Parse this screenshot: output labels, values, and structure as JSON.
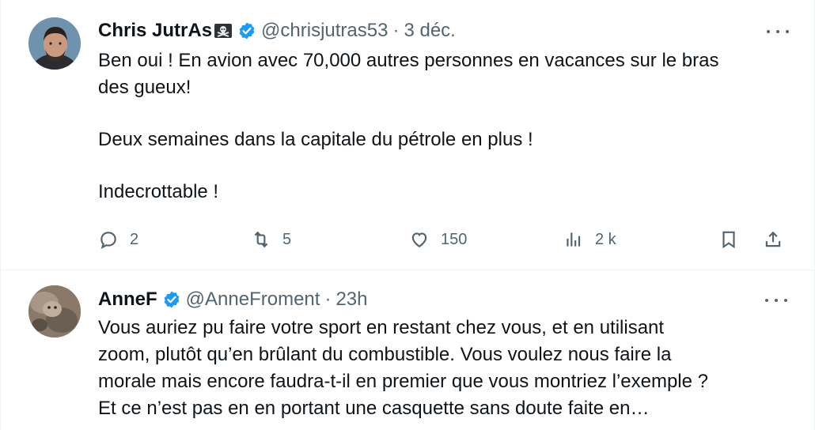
{
  "tweets": [
    {
      "author_name": "Chris JutrAs",
      "author_emoji": "pirate-flag-emoji",
      "handle": "@chrisjutras53",
      "separator": "·",
      "date": "3 déc.",
      "text_lines": [
        "Ben oui ! En avion avec 70,000 autres personnes en vacances sur le bras",
        "des gueux!",
        "",
        "Deux semaines dans la capitale du pétrole en plus !",
        "",
        "Indecrottable !"
      ],
      "actions": {
        "replies": "2",
        "reposts": "5",
        "likes": "150",
        "views": "2 k"
      }
    },
    {
      "author_name": "AnneF",
      "handle": "@AnneFroment",
      "separator": "·",
      "date": "23h",
      "text_lines": [
        "Vous auriez pu faire votre sport en restant chez vous, et en utilisant",
        "zoom, plutôt qu’en brûlant du combustible. Vous voulez nous faire la",
        "morale mais encore faudra-t-il en premier que vous montriez l’exemple ?",
        "Et ce n’est pas en en portant une casquette sans doute faite en…"
      ]
    }
  ],
  "colors": {
    "text_primary": "#0f1419",
    "text_secondary": "#536471",
    "verified_blue": "#1d9bf0",
    "divider": "#eff3f4"
  },
  "icons": {
    "reply": "reply-icon",
    "repost": "repost-icon",
    "like": "like-icon",
    "views": "views-icon",
    "bookmark": "bookmark-icon",
    "share": "share-icon",
    "more": "more-options-icon",
    "verified": "verified-badge-icon"
  }
}
